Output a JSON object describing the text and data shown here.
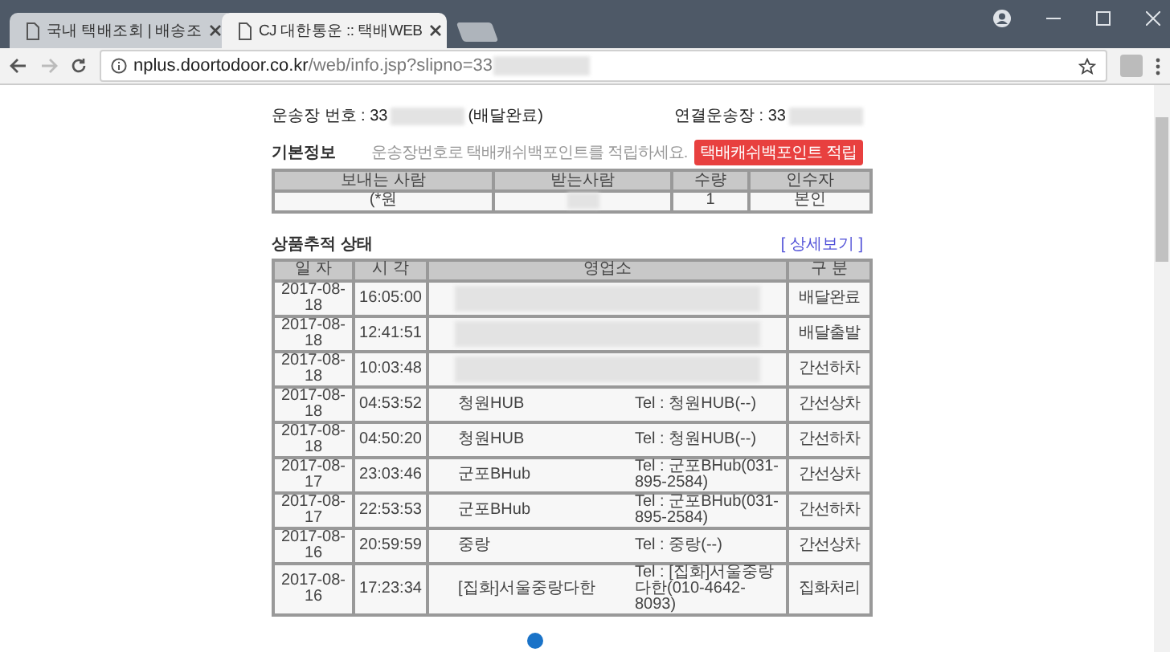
{
  "browser": {
    "tabs": [
      {
        "title": "국내 택배조회 | 배송조",
        "selected": false
      },
      {
        "title": "CJ 대한통운 :: 택배WEB",
        "selected": true
      }
    ],
    "url_host": "nplus.doortodoor.co.kr",
    "url_path": "/web/info.jsp?slipno=33"
  },
  "waybill": {
    "label": "운송장 번호 : 33",
    "status": "(배달완료)",
    "linked_label": "연결운송장 : 33"
  },
  "basic_info": {
    "title": "기본정보",
    "notice": "운송장번호로 택배캐쉬백포인트를 적립하세요.",
    "button": "택배캐쉬백포인트 적립",
    "columns": [
      "보내는 사람",
      "받는사람",
      "수량",
      "인수자"
    ],
    "row": [
      {
        "kind": "text",
        "text": "(*원"
      },
      {
        "kind": "blurred"
      },
      {
        "kind": "text",
        "text": "1"
      },
      {
        "kind": "text",
        "text": "본인"
      }
    ]
  },
  "tracking": {
    "title": "상품추적 상태",
    "detail_link": "[ 상세보기 ]",
    "columns": [
      "일 자",
      "시 각",
      "영업소",
      "구 분"
    ],
    "rows": [
      {
        "kind": "blurred",
        "date": "2017-08-18",
        "time": "16:05:00",
        "status": "배달완료"
      },
      {
        "kind": "blurred",
        "date": "2017-08-18",
        "time": "12:41:51",
        "status": "배달출발"
      },
      {
        "kind": "blurred",
        "date": "2017-08-18",
        "time": "10:03:48",
        "status": "간선하차"
      },
      {
        "kind": "text",
        "date": "2017-08-18",
        "time": "04:53:52",
        "branch": "청원HUB",
        "tel": "Tel : 청원HUB(--)",
        "status": "간선상차"
      },
      {
        "kind": "text",
        "date": "2017-08-18",
        "time": "04:50:20",
        "branch": "청원HUB",
        "tel": "Tel : 청원HUB(--)",
        "status": "간선하차"
      },
      {
        "kind": "text",
        "date": "2017-08-17",
        "time": "23:03:46",
        "branch": "군포BHub",
        "tel": "Tel : 군포BHub(031-895-2584)",
        "status": "간선상차"
      },
      {
        "kind": "text",
        "date": "2017-08-17",
        "time": "22:53:53",
        "branch": "군포BHub",
        "tel": "Tel : 군포BHub(031-895-2584)",
        "status": "간선하차"
      },
      {
        "kind": "text",
        "date": "2017-08-16",
        "time": "20:59:59",
        "branch": "중랑",
        "tel": "Tel : 중랑(--)",
        "status": "간선상차"
      },
      {
        "kind": "text",
        "date": "2017-08-16",
        "time": "17:23:34",
        "branch": "[집화]서울중랑다한",
        "tel": "Tel : [집화]서울중랑다한(010-4642-8093)",
        "status": "집화처리"
      }
    ]
  }
}
